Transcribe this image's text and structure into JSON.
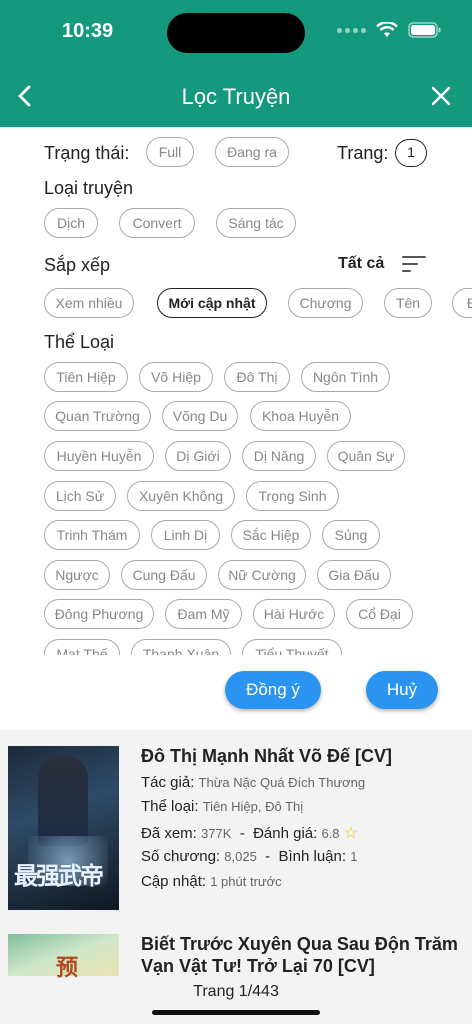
{
  "status": {
    "time": "10:39"
  },
  "header": {
    "title": "Lọc Truyện"
  },
  "filter": {
    "trang_thai_label": "Trạng thái:",
    "trang_thai_options": [
      "Full",
      "Đang ra"
    ],
    "trang_label": "Trang:",
    "trang_value": "1",
    "loai_label": "Loại truyện",
    "loai_options": [
      "Dịch",
      "Convert",
      "Sáng tác"
    ],
    "sap_xep_label": "Sắp xếp",
    "sort_all": "Tất cả",
    "sort_options": [
      "Xem nhiều",
      "Mới cập nhật",
      "Chương",
      "Tên",
      "Đ"
    ],
    "sort_selected": "Mới cập nhật",
    "the_loai_label": "Thể Loại",
    "genres": [
      "Tiên Hiệp",
      "Võ Hiệp",
      "Đô Thị",
      "Ngôn Tình",
      "Quan Trường",
      "Võng Du",
      "Khoa Huyễn",
      "Huyền Huyễn",
      "Dị Giới",
      "Dị Năng",
      "Quân Sự",
      "Lịch Sử",
      "Xuyên Không",
      "Trọng Sinh",
      "Trinh Thám",
      "Linh Dị",
      "Sắc Hiệp",
      "Sủng",
      "Ngược",
      "Cung Đấu",
      "Nữ Cường",
      "Gia Đấu",
      "Đông Phương",
      "Đam Mỹ",
      "Hài Hước",
      "Cổ Đại",
      "Mạt Thế",
      "Thanh Xuân",
      "Tiểu Thuyết"
    ],
    "agree_button": "Đồng ý",
    "cancel_button": "Huỷ"
  },
  "books": [
    {
      "title": "Đô Thị Mạnh Nhất Võ Đế [CV]",
      "author_label": "Tác giả:",
      "author": "Thừa Nặc Quá Đích Thương",
      "genre_label": "Thể loại:",
      "genre": "Tiên Hiệp, Đô Thị",
      "views_label": "Đã xem:",
      "views": "377K",
      "rating_label": "Đánh giá:",
      "rating": "6.8",
      "chapters_label": "Số chương:",
      "chapters": "8,025",
      "comments_label": "Bình luận:",
      "comments": "1",
      "updated_label": "Cập nhật:",
      "updated": "1 phút trước",
      "cover_text": "最强武帝"
    },
    {
      "title_line1": "Biết Trước Xuyên Qua Sau Độn Trăm",
      "title_line2": "Vạn Vật Tư! Trở Lại 70 [CV]",
      "cover_text": "预"
    }
  ],
  "pager": "Trang 1/443",
  "colors": {
    "header": "#14997f",
    "button": "#2a94f0",
    "star": "#f5c400"
  }
}
